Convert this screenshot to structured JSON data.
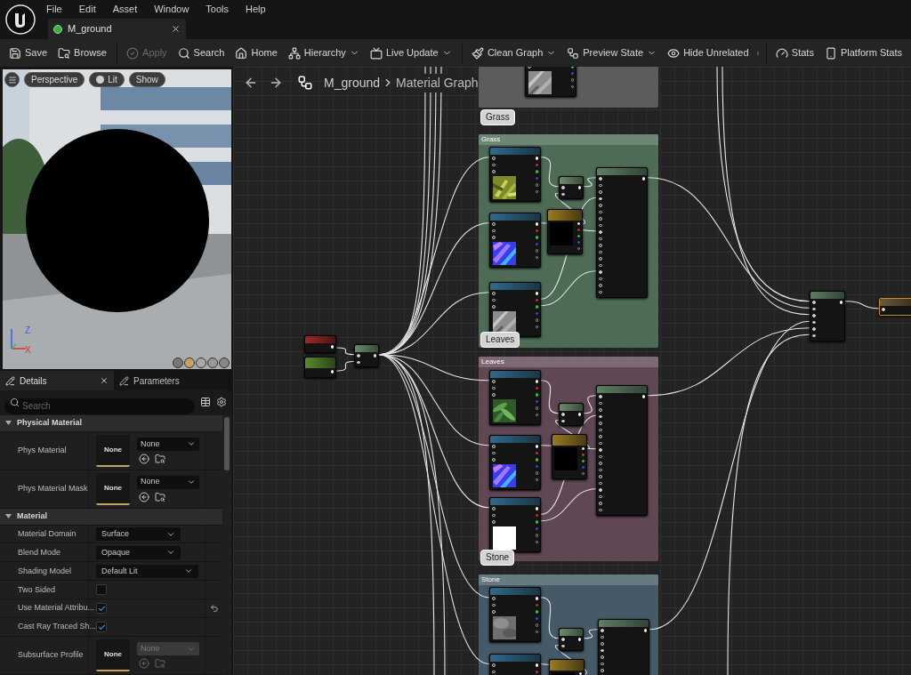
{
  "menu": [
    "File",
    "Edit",
    "Asset",
    "Window",
    "Tools",
    "Help"
  ],
  "document_tab": {
    "title": "M_ground",
    "selected": true
  },
  "toolbar_groups": [
    {
      "items": [
        {
          "label": "Save",
          "disabled": false,
          "dropdown": false
        },
        {
          "label": "Browse",
          "disabled": false,
          "dropdown": false
        }
      ]
    },
    {
      "items": [
        {
          "label": "Apply",
          "disabled": true,
          "dropdown": false
        },
        {
          "label": "Search",
          "disabled": false,
          "dropdown": false
        },
        {
          "label": "Home",
          "disabled": false,
          "dropdown": false
        },
        {
          "label": "Hierarchy",
          "disabled": false,
          "dropdown": true
        },
        {
          "label": "Live Update",
          "disabled": false,
          "dropdown": true
        }
      ]
    },
    {
      "items": [
        {
          "label": "Clean Graph",
          "disabled": false,
          "dropdown": true
        },
        {
          "label": "Preview State",
          "disabled": false,
          "dropdown": true
        },
        {
          "label": "Hide Unrelated",
          "disabled": false,
          "dropdown": false
        }
      ]
    },
    {
      "items": [
        {
          "label": "Stats",
          "disabled": false,
          "dropdown": false
        },
        {
          "label": "Platform Stats",
          "disabled": false,
          "dropdown": false
        }
      ]
    }
  ],
  "viewport": {
    "buttons": [
      "Perspective",
      "Lit",
      "Show"
    ],
    "axes": [
      "Z",
      "X"
    ]
  },
  "details": {
    "tabs": [
      {
        "label": "Details",
        "selected": true
      },
      {
        "label": "Parameters",
        "selected": false
      }
    ],
    "search": {
      "placeholder": "Search"
    },
    "sections": [
      {
        "title": "Physical Material",
        "expanded": true,
        "rows": [
          {
            "kind": "asset",
            "label": "Phys Material",
            "thumb": "None",
            "value": "None",
            "disabled": false,
            "reset": false
          },
          {
            "kind": "asset",
            "label": "Phys Material Mask",
            "thumb": "None",
            "value": "None",
            "disabled": false,
            "reset": false
          }
        ]
      },
      {
        "title": "Material",
        "expanded": true,
        "rows": [
          {
            "kind": "dropdown",
            "label": "Material Domain",
            "value": "Surface",
            "reset": false
          },
          {
            "kind": "dropdown",
            "label": "Blend Mode",
            "value": "Opaque",
            "reset": false
          },
          {
            "kind": "dropdown",
            "label": "Shading Model",
            "value": "Default Lit",
            "reset": false
          },
          {
            "kind": "checkbox",
            "label": "Two Sided",
            "checked": false,
            "reset": false
          },
          {
            "kind": "checkbox",
            "label": "Use Material Attribu...",
            "checked": true,
            "reset": true
          },
          {
            "kind": "checkbox",
            "label": "Cast Ray Traced Sh...",
            "checked": true,
            "reset": false
          },
          {
            "kind": "asset",
            "label": "Subsurface Profile",
            "thumb": "None",
            "value": "None",
            "disabled": true,
            "reset": false
          }
        ]
      }
    ]
  },
  "graph": {
    "breadcrumb": {
      "asset": "M_ground",
      "graph": "Material Graph"
    },
    "nodes": [
      {
        "kind": "coord"
      },
      {
        "kind": "scalar"
      },
      {
        "kind": "math"
      },
      {
        "kind": "blend"
      },
      {
        "kind": "output"
      }
    ],
    "comments": [
      {
        "color": "#5c5c5c",
        "nodes": [
          {
            "kind": "texture"
          }
        ]
      },
      {
        "title": "Grass",
        "bubble": "Grass",
        "color": "#4d6b55",
        "nodes": [
          {
            "kind": "texture"
          },
          {
            "kind": "texture"
          },
          {
            "kind": "texture"
          },
          {
            "kind": "math"
          },
          {
            "kind": "vector"
          },
          {
            "kind": "attributes"
          }
        ]
      },
      {
        "title": "Leaves",
        "bubble": "Leaves",
        "color": "#5f4854",
        "nodes": [
          {
            "kind": "texture"
          },
          {
            "kind": "texture"
          },
          {
            "kind": "texture"
          },
          {
            "kind": "math"
          },
          {
            "kind": "vector"
          },
          {
            "kind": "attributes"
          }
        ]
      },
      {
        "title": "Stone",
        "bubble": "Stone",
        "color": "#455a66",
        "nodes": [
          {
            "kind": "texture"
          },
          {
            "kind": "texture"
          },
          {
            "kind": "math"
          },
          {
            "kind": "vector"
          },
          {
            "kind": "attributes"
          }
        ]
      }
    ]
  }
}
